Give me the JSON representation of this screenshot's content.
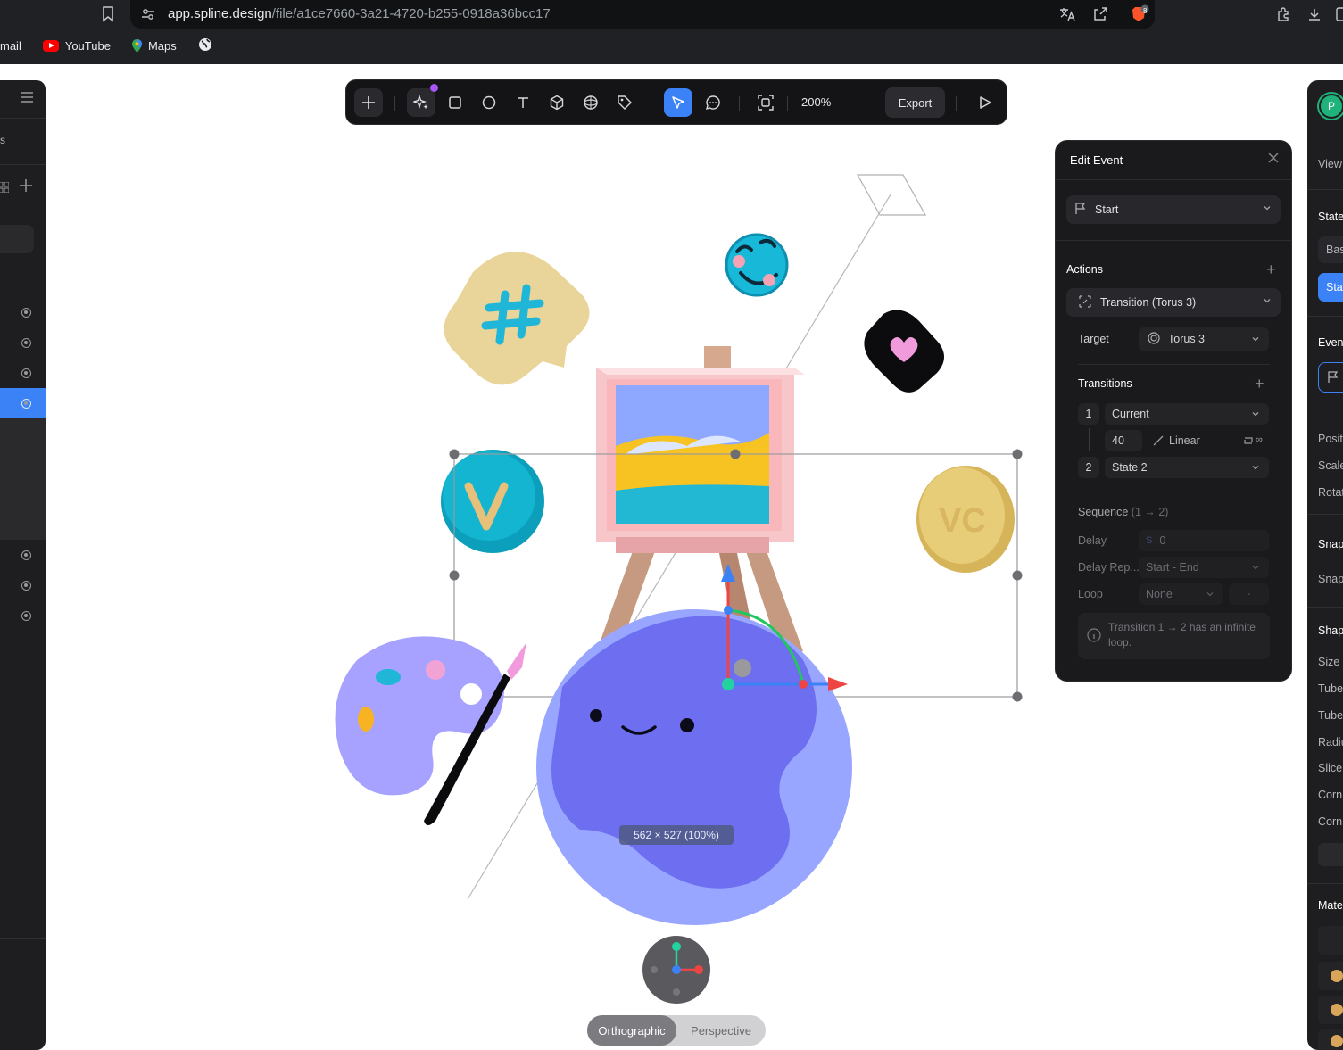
{
  "browser": {
    "url_domain": "app.spline.design",
    "url_path": "/file/a1ce7660-3a21-4720-b255-0918a36bcc17",
    "bookmarks": [
      {
        "label": "mail",
        "icon": "gmail-icon"
      },
      {
        "label": "YouTube",
        "icon": "youtube-icon"
      },
      {
        "label": "Maps",
        "icon": "maps-icon"
      },
      {
        "label": "",
        "icon": "globe-icon"
      }
    ],
    "brave_badge": "8"
  },
  "toolbar": {
    "zoom": "200%",
    "export_label": "Export",
    "tools": [
      "add-icon",
      "ai-sparkle-icon",
      "rectangle-icon",
      "ellipse-icon",
      "text-icon",
      "cube-icon",
      "sphere-icon",
      "tag-icon",
      "select-pointer-icon",
      "comment-icon",
      "frame-icon",
      "play-icon"
    ]
  },
  "left_panel": {
    "partial_label": "s"
  },
  "canvas": {
    "dimension_tag": "562 × 527 (100%)",
    "view_modes": {
      "active": "Orthographic",
      "inactive": "Perspective"
    }
  },
  "event_panel": {
    "title": "Edit Event",
    "trigger": "Start",
    "actions_heading": "Actions",
    "action": "Transition (Torus 3)",
    "target_label": "Target",
    "target_value": "Torus 3",
    "transitions_heading": "Transitions",
    "transitions": [
      {
        "index": "1",
        "state": "Current"
      },
      {
        "index": "2",
        "state": "State 2"
      }
    ],
    "duration": "40",
    "easing": "Linear",
    "loop_symbol": "∞",
    "sequence_label": "Sequence",
    "sequence_value": "(1 → 2)",
    "delay_label": "Delay",
    "delay_unit": "S",
    "delay_value": "0",
    "delay_repeat_label": "Delay Rep...",
    "delay_repeat_value": "Start - End",
    "loop_label": "Loop",
    "loop_value": "None",
    "loop_extra": "-",
    "note": "Transition 1 → 2 has an infinite loop."
  },
  "right_panel": {
    "avatar_initial": "P",
    "labels": {
      "view": "View",
      "states": "State",
      "base": "Bas",
      "state_tab": "Sta",
      "events": "Even",
      "position": "Posit",
      "scale": "Scale",
      "rotation": "Rotat",
      "snap_heading": "Snap",
      "snap": "Snap",
      "shape_heading": "Shap",
      "size": "Size",
      "tube1": "Tube",
      "tube2": "Tube",
      "radius": "Radiu",
      "slices": "Slice",
      "corner1": "Corn",
      "corner2": "Corn",
      "material": "Mate"
    }
  },
  "colors": {
    "accent": "#3b82f6",
    "panel": "#1a1a1c",
    "globe": "#6d6ef0",
    "axis_x": "#ef4444",
    "axis_y": "#3b82f6",
    "axis_z": "#22c55e"
  }
}
